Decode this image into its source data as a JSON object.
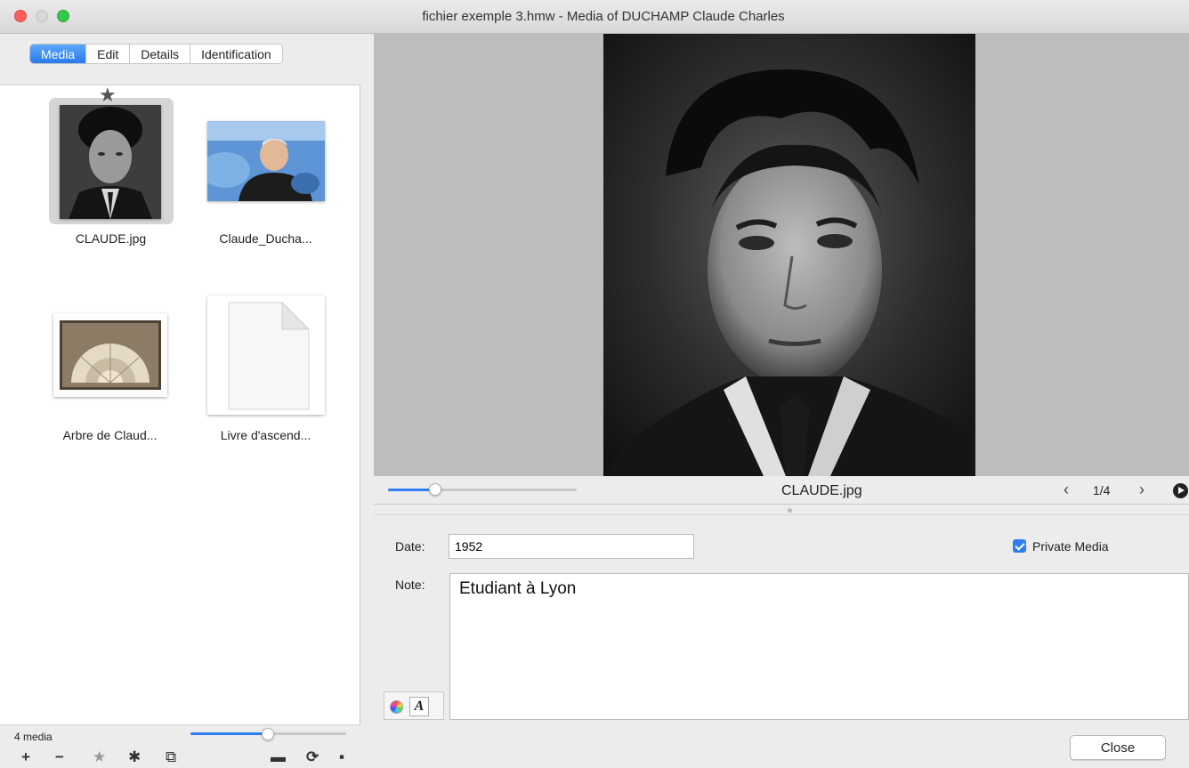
{
  "window": {
    "title": "fichier exemple 3.hmw - Media of DUCHAMP Claude Charles"
  },
  "tabs": [
    {
      "label": "Media",
      "active": true
    },
    {
      "label": "Edit",
      "active": false
    },
    {
      "label": "Details",
      "active": false
    },
    {
      "label": "Identification",
      "active": false
    }
  ],
  "media_items": [
    {
      "label": "CLAUDE.jpg",
      "selected": true,
      "starred": true,
      "icon": "portrait-thumbnail"
    },
    {
      "label": "Claude_Ducha...",
      "selected": false,
      "starred": false,
      "icon": "photo-thumbnail"
    },
    {
      "label": "Arbre de Claud...",
      "selected": false,
      "starred": false,
      "icon": "family-tree-thumbnail"
    },
    {
      "label": "Livre d'ascend...",
      "selected": false,
      "starred": false,
      "icon": "document-thumbnail"
    }
  ],
  "left_footer": {
    "count_label": "4 media",
    "thumb_size_fraction": 0.5,
    "tools": [
      "add-icon",
      "remove-icon",
      "star-icon",
      "gear-icon",
      "copy-icon",
      "folder-icon",
      "refresh-icon",
      "save-icon"
    ],
    "tool_glyphs": [
      "+",
      "−",
      "★",
      "✱",
      "⧉",
      "▬",
      "⟳",
      "▪"
    ]
  },
  "viewer": {
    "filename": "CLAUDE.jpg",
    "page_indicator": "1/4",
    "zoom_fraction": 0.28,
    "prev_glyph": "‹",
    "next_glyph": "›"
  },
  "form": {
    "date_label": "Date:",
    "date_value": "1952",
    "note_label": "Note:",
    "note_value": "Etudiant à Lyon",
    "private_label": "Private Media",
    "private_checked": true,
    "font_glyph": "A",
    "close_label": "Close"
  },
  "colors": {
    "accent": "#2f7ef5",
    "close_light": "#fc605b",
    "max_light": "#34c84a"
  }
}
